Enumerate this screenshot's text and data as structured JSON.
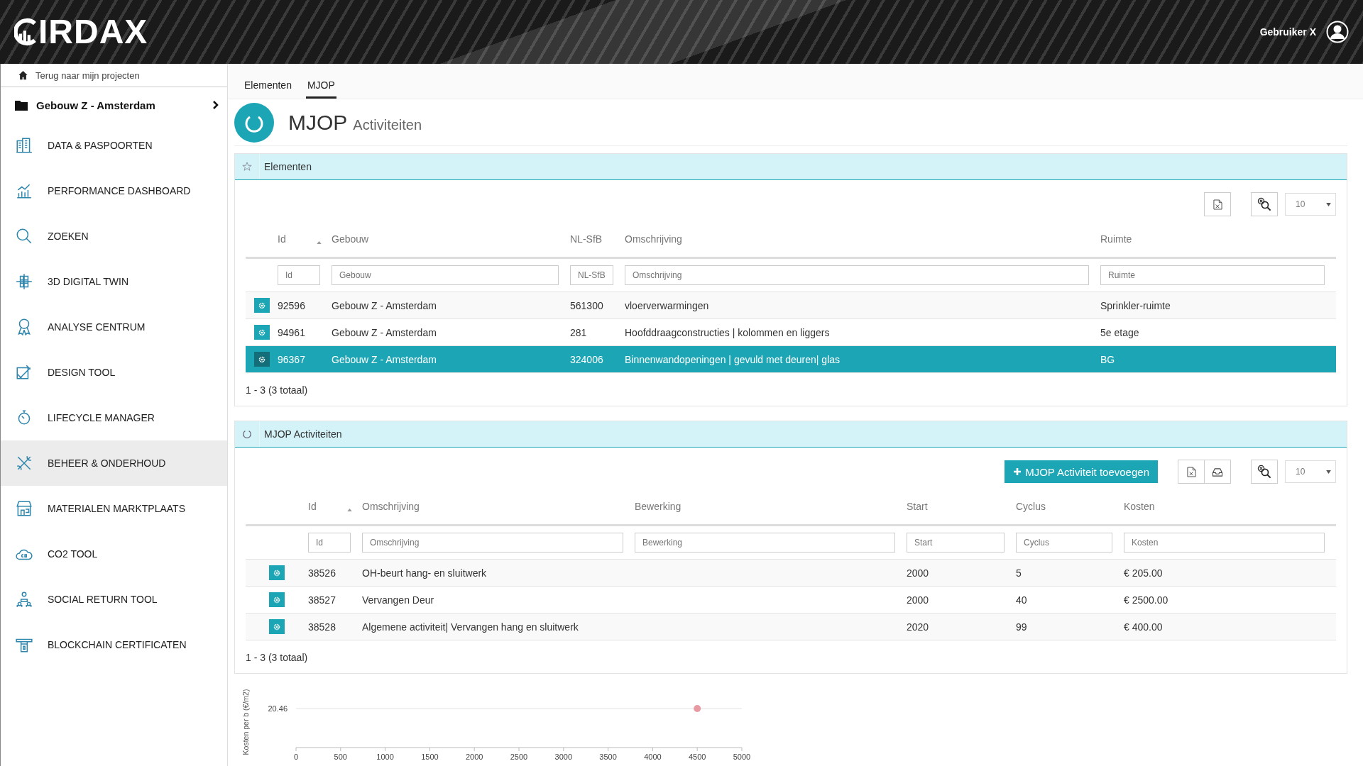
{
  "header": {
    "logo": "IRDAX",
    "user": "Gebruiker X"
  },
  "sidebar": {
    "back": "Terug naar mijn projecten",
    "project": "Gebouw Z - Amsterdam",
    "items": [
      {
        "label": "DATA & PASPOORTEN",
        "selected": false
      },
      {
        "label": "PERFORMANCE DASHBOARD",
        "selected": false
      },
      {
        "label": "ZOEKEN",
        "selected": false
      },
      {
        "label": "3D DIGITAL TWIN",
        "selected": false
      },
      {
        "label": "ANALYSE CENTRUM",
        "selected": false
      },
      {
        "label": "DESIGN TOOL",
        "selected": false
      },
      {
        "label": "LIFECYCLE MANAGER",
        "selected": false
      },
      {
        "label": "BEHEER & ONDERHOUD",
        "selected": true
      },
      {
        "label": "MATERIALEN MARKTPLAATS",
        "selected": false
      },
      {
        "label": "CO2 TOOL",
        "selected": false
      },
      {
        "label": "SOCIAL RETURN TOOL",
        "selected": false
      },
      {
        "label": "BLOCKCHAIN CERTIFICATEN",
        "selected": false
      }
    ]
  },
  "tabs": [
    {
      "label": "Elementen",
      "selected": false
    },
    {
      "label": "MJOP",
      "selected": true
    }
  ],
  "page": {
    "title": "MJOP",
    "subtitle": "Activiteiten"
  },
  "panels": [
    {
      "title": "Elementen",
      "toolbar": [
        {
          "kind": "excel"
        },
        {
          "kind": "clear-filter"
        },
        {
          "kind": "page-size",
          "value": "10"
        }
      ],
      "table": {
        "columns": [
          {
            "label": "Id",
            "sorted": true,
            "placeholder": "Id"
          },
          {
            "label": "Gebouw",
            "sorted": false,
            "placeholder": "Gebouw"
          },
          {
            "label": "NL-SfB",
            "sorted": false,
            "placeholder": "NL-SfB"
          },
          {
            "label": "Omschrijving",
            "sorted": false,
            "placeholder": "Omschrijving"
          },
          {
            "label": "Ruimte",
            "sorted": false,
            "placeholder": "Ruimte"
          }
        ],
        "rows": [
          {
            "selected": false,
            "cells": [
              "92596",
              "Gebouw Z - Amsterdam",
              "561300",
              "vloerverwarmingen",
              "Sprinkler-ruimte"
            ]
          },
          {
            "selected": false,
            "cells": [
              "94961",
              "Gebouw Z - Amsterdam",
              "281",
              "Hoofddraagconstructies | kolommen en liggers",
              "5e etage"
            ]
          },
          {
            "selected": true,
            "cells": [
              "96367",
              "Gebouw Z - Amsterdam",
              "324006",
              "Binnenwandopeningen | gevuld met deuren| glas",
              "BG"
            ]
          }
        ]
      },
      "footer": "1 - 3 (3 totaal)"
    },
    {
      "title": "MJOP Activiteiten",
      "toolbar": [
        {
          "kind": "add",
          "label": "MJOP Activiteit toevoegen"
        },
        {
          "kind": "excel"
        },
        {
          "kind": "inbox"
        },
        {
          "kind": "clear-filter"
        },
        {
          "kind": "page-size",
          "value": "10"
        }
      ],
      "table": {
        "columns": [
          {
            "label": "Id",
            "sorted": true,
            "placeholder": "Id"
          },
          {
            "label": "Omschrijving",
            "sorted": false,
            "placeholder": "Omschrijving"
          },
          {
            "label": "Bewerking",
            "sorted": false,
            "placeholder": "Bewerking"
          },
          {
            "label": "Start",
            "sorted": false,
            "placeholder": "Start"
          },
          {
            "label": "Cyclus",
            "sorted": false,
            "placeholder": "Cyclus"
          },
          {
            "label": "Kosten",
            "sorted": false,
            "placeholder": "Kosten"
          }
        ],
        "rows": [
          {
            "selected": false,
            "cells": [
              "38526",
              "OH-beurt hang- en sluitwerk",
              "",
              "2000",
              "5",
              "€ 205.00"
            ]
          },
          {
            "selected": false,
            "cells": [
              "38527",
              "Vervangen Deur",
              "",
              "2000",
              "40",
              "€ 2500.00"
            ]
          },
          {
            "selected": false,
            "cells": [
              "38528",
              "Algemene activiteit| Vervangen hang en sluitwerk",
              "",
              "2020",
              "99",
              "€ 400.00"
            ]
          }
        ]
      },
      "footer": "1 - 3 (3 totaal)"
    }
  ],
  "cost_chart": {
    "y_axis_title": "Kosten per b (€/m2)",
    "y_label": "20.46",
    "x_labels": [
      "0",
      "500",
      "1000",
      "1500",
      "2000",
      "2500",
      "3000",
      "3500",
      "4000",
      "4500",
      "5000"
    ]
  }
}
